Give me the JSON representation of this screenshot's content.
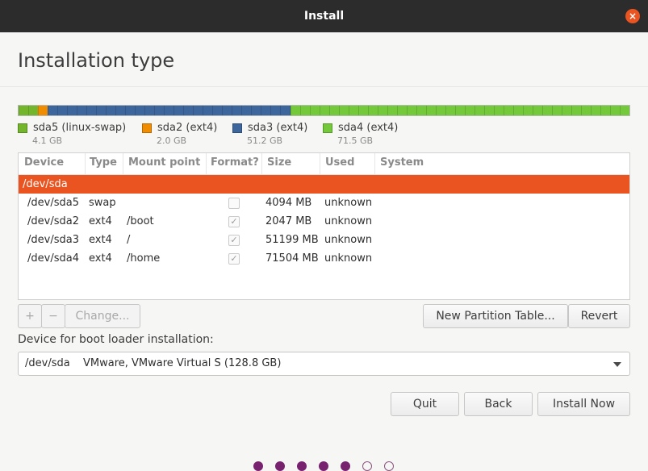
{
  "window": {
    "title": "Install",
    "close_glyph": "×"
  },
  "page_title": "Installation type",
  "partition_bar": {
    "colors": {
      "swap": "#73b52b",
      "boot": "#f08c00",
      "root": "#3d679c",
      "home": "#73c93a"
    }
  },
  "legend": [
    {
      "label": "sda5 (linux-swap)",
      "size": "4.1 GB",
      "color": "#73b52b"
    },
    {
      "label": "sda2 (ext4)",
      "size": "2.0 GB",
      "color": "#f08c00"
    },
    {
      "label": "sda3 (ext4)",
      "size": "51.2 GB",
      "color": "#3d679c"
    },
    {
      "label": "sda4 (ext4)",
      "size": "71.5 GB",
      "color": "#73c93a"
    }
  ],
  "table": {
    "columns": [
      "Device",
      "Type",
      "Mount point",
      "Format?",
      "Size",
      "Used",
      "System"
    ],
    "disk_row": "/dev/sda",
    "rows": [
      {
        "device": "/dev/sda5",
        "type": "swap",
        "mount": "",
        "format": false,
        "size": "4094 MB",
        "used": "unknown"
      },
      {
        "device": "/dev/sda2",
        "type": "ext4",
        "mount": "/boot",
        "format": true,
        "size": "2047 MB",
        "used": "unknown"
      },
      {
        "device": "/dev/sda3",
        "type": "ext4",
        "mount": "/",
        "format": true,
        "size": "51199 MB",
        "used": "unknown"
      },
      {
        "device": "/dev/sda4",
        "type": "ext4",
        "mount": "/home",
        "format": true,
        "size": "71504 MB",
        "used": "unknown"
      }
    ]
  },
  "toolbar": {
    "add": "+",
    "remove": "−",
    "change": "Change...",
    "new_table": "New Partition Table...",
    "revert": "Revert"
  },
  "boot_loader": {
    "label": "Device for boot loader installation:",
    "device": "/dev/sda",
    "description": "VMware, VMware Virtual S (128.8 GB)"
  },
  "actions": {
    "quit": "Quit",
    "back": "Back",
    "install": "Install Now"
  },
  "progress": {
    "total_steps": 7,
    "completed_steps": 5
  }
}
